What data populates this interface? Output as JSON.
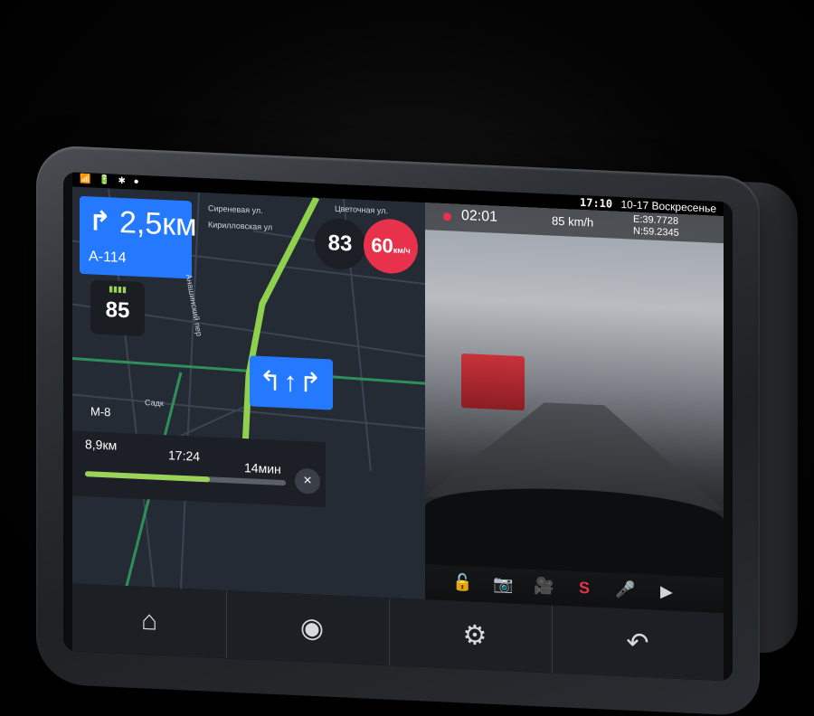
{
  "status_bar": {
    "icons": [
      "📶",
      "🔋",
      "✱",
      "●"
    ],
    "time": "17:10",
    "date": "10-17 Воскресенье"
  },
  "navigation": {
    "turn_arrow": "↱",
    "turn_distance": "2,5км",
    "road_name": "А-114",
    "lane_indicator": "▮▮▮▮",
    "speed_tile_value": "85",
    "current_speed": "83",
    "speed_limit": "60",
    "speed_limit_unit": "км/ч",
    "lane_arrows": "↰↑↱",
    "streets": [
      "Сиреневая ул.",
      "Цветочная ул.",
      "Кирилловская ул",
      "Анашинский пер",
      "Садк"
    ],
    "road_label": "М-8",
    "eta": {
      "distance": "8,9км",
      "arrival_time": "17:24",
      "duration": "14мин",
      "progress": 0.62,
      "close_icon": "×"
    }
  },
  "camera": {
    "rec_time": "02:01",
    "speed": "85 km/h",
    "gps_e": "E:39.7728",
    "gps_n": "N:59.2345",
    "toolbar": [
      "🔓",
      "📷",
      "🎥",
      "S",
      "🎤",
      "▶"
    ]
  },
  "bottom_nav": [
    {
      "name": "home",
      "icon": "⌂"
    },
    {
      "name": "camera",
      "icon": "◉"
    },
    {
      "name": "settings",
      "icon": "⚙"
    },
    {
      "name": "back",
      "icon": "↶"
    }
  ],
  "colors": {
    "accent_blue": "#2479ff",
    "limit_red": "#e8314a",
    "route_green": "#9bd35a"
  }
}
